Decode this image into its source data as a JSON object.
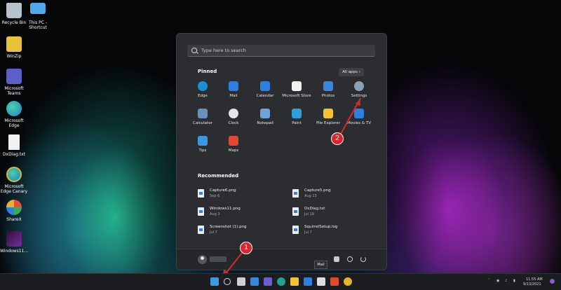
{
  "desktop": {
    "icons": [
      {
        "label": "Recycle Bin",
        "icon": "recycle-bin-icon",
        "color": "#b8c2cc"
      },
      {
        "label": "This PC - Shortcut",
        "icon": "monitor-icon",
        "color": "#4fa8e8"
      },
      {
        "label": "WinZip",
        "icon": "winzip-icon",
        "color": "#e9c23a"
      },
      {
        "label": "Microsoft Teams",
        "icon": "teams-icon",
        "color": "#5b5fc7"
      },
      {
        "label": "Microsoft Edge",
        "icon": "edge-icon",
        "color": "#1fa38a"
      },
      {
        "label": "DxDiag.txt",
        "icon": "text-file-icon",
        "color": "#f2f2f2"
      },
      {
        "label": "Microsoft Edge Canary",
        "icon": "edge-canary-icon",
        "color": "#e3b528"
      },
      {
        "label": "ShareX",
        "icon": "sharex-icon",
        "color": "#e84a3c"
      },
      {
        "label": "Windows11...",
        "icon": "image-file-icon",
        "color": "#7a2fa0"
      }
    ]
  },
  "start_menu": {
    "search_placeholder": "Type here to search",
    "pinned_title": "Pinned",
    "all_apps_label": "All apps",
    "pinned": [
      {
        "label": "Edge",
        "icon": "edge-icon",
        "color": "#1e8fd6"
      },
      {
        "label": "Mail",
        "icon": "mail-icon",
        "color": "#2f7fe0"
      },
      {
        "label": "Calendar",
        "icon": "calendar-icon",
        "color": "#2f7fe0"
      },
      {
        "label": "Microsoft Store",
        "icon": "store-icon",
        "color": "#f2f2f2"
      },
      {
        "label": "Photos",
        "icon": "photos-icon",
        "color": "#3a86d8"
      },
      {
        "label": "Settings",
        "icon": "gear-icon",
        "color": "#8aa0b4"
      },
      {
        "label": "Calculator",
        "icon": "calculator-icon",
        "color": "#6a8fb8"
      },
      {
        "label": "Clock",
        "icon": "clock-icon",
        "color": "#e6e6e6"
      },
      {
        "label": "Notepad",
        "icon": "notepad-icon",
        "color": "#6fa3d8"
      },
      {
        "label": "Paint",
        "icon": "paint-icon",
        "color": "#2ea0d8"
      },
      {
        "label": "File Explorer",
        "icon": "folder-icon",
        "color": "#f2c230"
      },
      {
        "label": "Movies & TV",
        "icon": "play-icon",
        "color": "#2f7fe0"
      },
      {
        "label": "Tips",
        "icon": "tips-icon",
        "color": "#3a9ae0"
      },
      {
        "label": "Maps",
        "icon": "map-pin-icon",
        "color": "#e0492f"
      }
    ],
    "recommended_title": "Recommended",
    "recommended": [
      {
        "name": "Capture6.png",
        "date": "Sep 6"
      },
      {
        "name": "Capture5.png",
        "date": "Aug 13"
      },
      {
        "name": "Windows11.png",
        "date": "Aug 3"
      },
      {
        "name": "DxDiag.txt",
        "date": "Jul 19"
      },
      {
        "name": "Screenshot (1).png",
        "date": "Jul 7"
      },
      {
        "name": "SquirrelSetup.log",
        "date": "Jul 7"
      }
    ]
  },
  "annotations": {
    "badge_1": "1",
    "badge_2": "2",
    "accent": "#d9272e"
  },
  "tooltip": "Mail",
  "taskbar": {
    "icons": [
      "windows-start-icon",
      "search-icon",
      "task-view-icon",
      "widgets-icon",
      "chat-icon",
      "edge-icon",
      "file-explorer-icon",
      "mail-icon",
      "store-icon",
      "maps-icon",
      "chrome-icon"
    ]
  },
  "tray": {
    "time": "11:55 AM",
    "date": "9/13/2021"
  }
}
